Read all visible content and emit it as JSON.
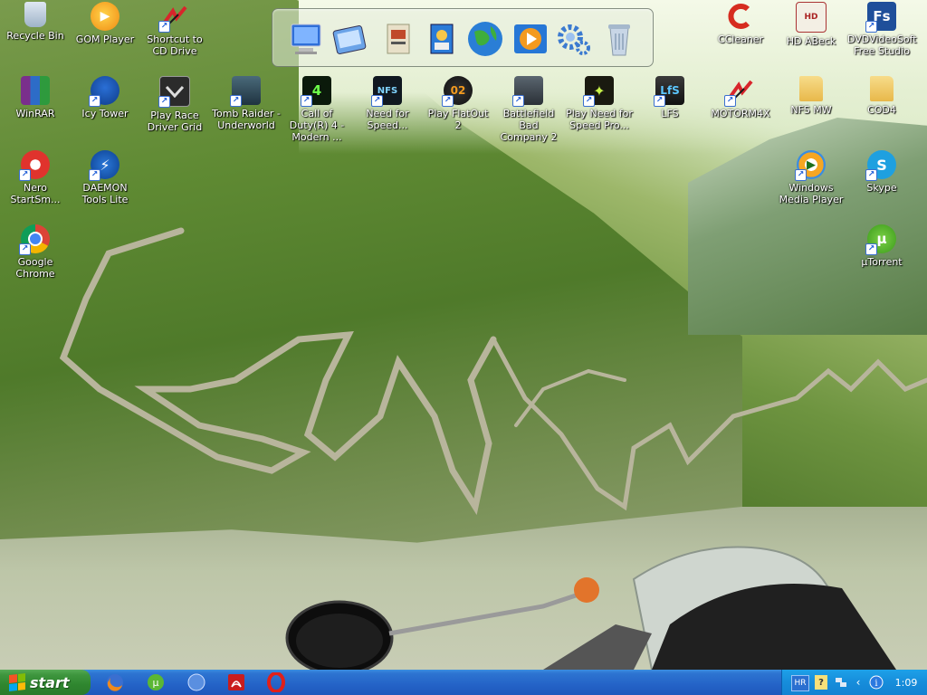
{
  "desktop": {
    "icons": [
      {
        "label": "Recycle Bin",
        "icon": "recycle-bin-icon",
        "shortcut": false
      },
      {
        "label": "GOM Player",
        "icon": "gom-player-icon",
        "shortcut": false
      },
      {
        "label": "Shortcut to CD Drive",
        "icon": "motorm4x-icon",
        "shortcut": true
      },
      {
        "label": "CCleaner",
        "icon": "ccleaner-icon",
        "shortcut": false
      },
      {
        "label": "HD ABeck",
        "icon": "hd-abeck-icon",
        "shortcut": false
      },
      {
        "label": "DVDVideoSoft Free Studio",
        "icon": "dvdvideosoft-icon",
        "shortcut": true
      },
      {
        "label": "WinRAR",
        "icon": "winrar-icon",
        "shortcut": false
      },
      {
        "label": "Icy Tower",
        "icon": "icy-tower-icon",
        "shortcut": true
      },
      {
        "label": "Play Race Driver Grid",
        "icon": "race-driver-grid-icon",
        "shortcut": true
      },
      {
        "label": "Tomb Raider - Underworld",
        "icon": "tomb-raider-icon",
        "shortcut": true
      },
      {
        "label": "Call of Duty(R) 4 - Modern ...",
        "icon": "call-of-duty-icon",
        "shortcut": true
      },
      {
        "label": "Need for Speed...",
        "icon": "need-for-speed-icon",
        "shortcut": true
      },
      {
        "label": "Play FlatOut 2",
        "icon": "flatout-2-icon",
        "shortcut": true
      },
      {
        "label": "Battlefield Bad Company 2",
        "icon": "battlefield-icon",
        "shortcut": true
      },
      {
        "label": "Play Need for Speed Pro...",
        "icon": "nfs-prostreet-icon",
        "shortcut": true
      },
      {
        "label": "LFS",
        "icon": "lfs-icon",
        "shortcut": true
      },
      {
        "label": "MOTORM4X",
        "icon": "motorm4x-icon",
        "shortcut": true
      },
      {
        "label": "NFS MW",
        "icon": "folder-icon",
        "shortcut": false
      },
      {
        "label": "COD4",
        "icon": "folder-icon",
        "shortcut": false
      },
      {
        "label": "Nero StartSm...",
        "icon": "nero-icon",
        "shortcut": true
      },
      {
        "label": "DAEMON Tools Lite",
        "icon": "daemon-tools-icon",
        "shortcut": true
      },
      {
        "label": "Windows Media Player",
        "icon": "windows-media-player-icon",
        "shortcut": true
      },
      {
        "label": "Skype",
        "icon": "skype-icon",
        "shortcut": true
      },
      {
        "label": "Google Chrome",
        "icon": "google-chrome-icon",
        "shortcut": true
      },
      {
        "label": "µTorrent",
        "icon": "utorrent-icon",
        "shortcut": true
      }
    ]
  },
  "dock": {
    "items": [
      "my-computer-icon",
      "control-panel-icon",
      "my-documents-icon",
      "my-pictures-icon",
      "internet-globe-icon",
      "media-player-icon",
      "settings-gears-icon",
      "recycle-bin-icon"
    ]
  },
  "taskbar": {
    "start_label": "start",
    "quick_launch": [
      "firefox-icon",
      "utorrent-icon",
      "globe-icon",
      "adobe-reader-icon",
      "opera-icon"
    ],
    "tray": {
      "language": "HR",
      "clock": "1:09"
    }
  },
  "colors": {
    "taskbar": "#2463c7",
    "start_button": "#3e963e",
    "tray": "#168ddb"
  }
}
